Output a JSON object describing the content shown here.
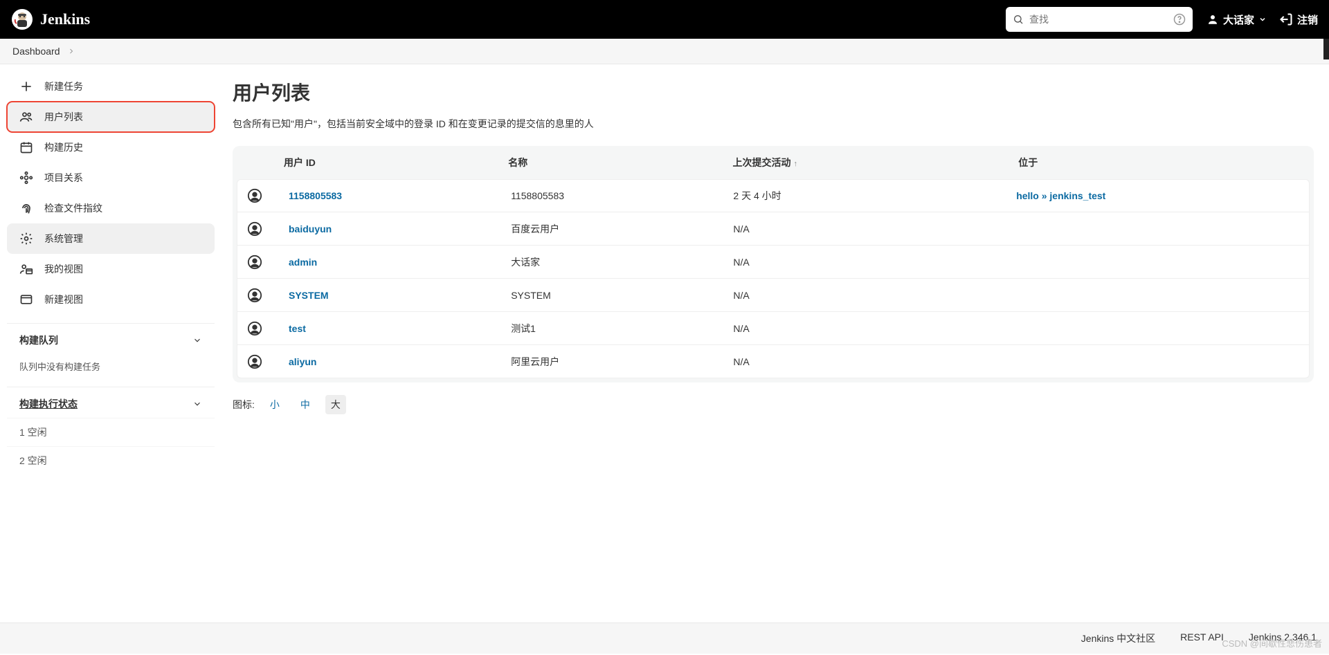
{
  "header": {
    "brand": "Jenkins",
    "search_placeholder": "查找",
    "user": "大话家",
    "logout": "注销"
  },
  "breadcrumb": {
    "root": "Dashboard"
  },
  "sidebar": {
    "items": [
      {
        "label": "新建任务"
      },
      {
        "label": "用户列表"
      },
      {
        "label": "构建历史"
      },
      {
        "label": "项目关系"
      },
      {
        "label": "检查文件指纹"
      },
      {
        "label": "系统管理"
      },
      {
        "label": "我的视图"
      },
      {
        "label": "新建视图"
      }
    ],
    "queue_title": "构建队列",
    "queue_empty": "队列中没有构建任务",
    "exec_title": "构建执行状态",
    "exec_rows": [
      {
        "id": "1",
        "status": "空闲"
      },
      {
        "id": "2",
        "status": "空闲"
      }
    ]
  },
  "main": {
    "title": "用户列表",
    "desc": "包含所有已知\"用户\"，包括当前安全域中的登录 ID 和在变更记录的提交信的息里的人",
    "columns": {
      "userid": "用户 ID",
      "name": "名称",
      "last": "上次提交活动",
      "sort": "↑",
      "on": "位于"
    },
    "rows": [
      {
        "userid": "1158805583",
        "name": "1158805583",
        "last": "2 天 4 小时",
        "on_text": "hello » jenkins_test",
        "on_link": true
      },
      {
        "userid": "baiduyun",
        "name": "百度云用户",
        "last": "N/A",
        "on_text": "",
        "on_link": false
      },
      {
        "userid": "admin",
        "name": "大话家",
        "last": "N/A",
        "on_text": "",
        "on_link": false
      },
      {
        "userid": "SYSTEM",
        "name": "SYSTEM",
        "last": "N/A",
        "on_text": "",
        "on_link": false
      },
      {
        "userid": "test",
        "name": "测试1",
        "last": "N/A",
        "on_text": "",
        "on_link": false
      },
      {
        "userid": "aliyun",
        "name": "阿里云用户",
        "last": "N/A",
        "on_text": "",
        "on_link": false
      }
    ],
    "iconsize": {
      "label": "图标:",
      "small": "小",
      "medium": "中",
      "large": "大",
      "selected": "large"
    }
  },
  "footer": {
    "community": "Jenkins 中文社区",
    "restapi": "REST API",
    "version": "Jenkins 2.346.1"
  },
  "watermark": "CSDN @间歇性悲伤患者"
}
